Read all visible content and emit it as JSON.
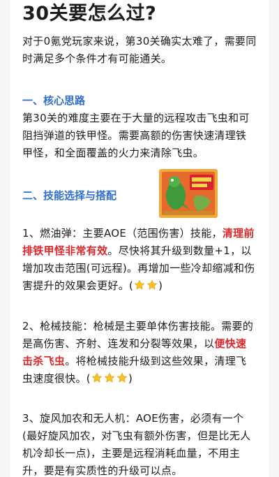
{
  "title": "30关要怎么过?",
  "intro": "对于0氪党玩家来说，第30关确实太难了，需要同时满足多个条件才有可能通关。",
  "section1": {
    "heading": "一、核心思路",
    "body": "第30关的难度主要在于大量的远程攻击飞虫和可阻挡弹道的铁甲怪。需要高额的伤害快速清理铁甲怪，和全面覆盖的火力来清除飞虫。"
  },
  "section2": {
    "heading": "二、技能选择与搭配",
    "item1": {
      "pre": "1、燃油弹：主要AOE（范围伤害）技能，",
      "red": "清理前排铁甲怪非常有效",
      "post": "。尽快将其升级到数量+1，以增加攻击范围(可远程)。再增加一些冷却缩减和伤害提升的效果会更好。(",
      "end": ")",
      "stars": 2
    },
    "item2": {
      "pre": "2、枪械技能：枪械是主要单体伤害技能。需要的是高伤害、齐射、连发和分裂等效果，以",
      "red": "便快速击杀飞虫",
      "post": "。将枪械技能升级到这些效果，清理飞虫速度很快。(",
      "end": ")",
      "stars": 3
    },
    "item3": {
      "text": "3、旋风加农和无人机：AOE伤害，必须有一个(最好旋风加农，对飞虫有额外伤害，但是比无人机冷却长一点)，主要是远程消耗血量，不用主升，要是有实质性的升级可以点。"
    }
  },
  "colors": {
    "accent_blue": "#2f6fd3",
    "highlight_red": "#e0262b",
    "star_gold": "#f6c323"
  },
  "icons": [
    "star-icon",
    "toy-sticker-image"
  ]
}
